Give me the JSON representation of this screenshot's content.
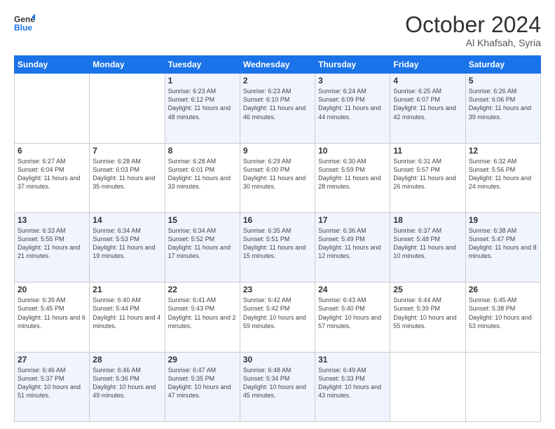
{
  "header": {
    "logo_line1": "General",
    "logo_line2": "Blue",
    "month": "October 2024",
    "location": "Al Khafsah, Syria"
  },
  "days_of_week": [
    "Sunday",
    "Monday",
    "Tuesday",
    "Wednesday",
    "Thursday",
    "Friday",
    "Saturday"
  ],
  "weeks": [
    [
      {
        "day": "",
        "empty": true
      },
      {
        "day": "",
        "empty": true
      },
      {
        "day": "1",
        "line1": "Sunrise: 6:23 AM",
        "line2": "Sunset: 6:12 PM",
        "line3": "Daylight: 11 hours and 48 minutes."
      },
      {
        "day": "2",
        "line1": "Sunrise: 6:23 AM",
        "line2": "Sunset: 6:10 PM",
        "line3": "Daylight: 11 hours and 46 minutes."
      },
      {
        "day": "3",
        "line1": "Sunrise: 6:24 AM",
        "line2": "Sunset: 6:09 PM",
        "line3": "Daylight: 11 hours and 44 minutes."
      },
      {
        "day": "4",
        "line1": "Sunrise: 6:25 AM",
        "line2": "Sunset: 6:07 PM",
        "line3": "Daylight: 11 hours and 42 minutes."
      },
      {
        "day": "5",
        "line1": "Sunrise: 6:26 AM",
        "line2": "Sunset: 6:06 PM",
        "line3": "Daylight: 11 hours and 39 minutes."
      }
    ],
    [
      {
        "day": "6",
        "line1": "Sunrise: 6:27 AM",
        "line2": "Sunset: 6:04 PM",
        "line3": "Daylight: 11 hours and 37 minutes."
      },
      {
        "day": "7",
        "line1": "Sunrise: 6:28 AM",
        "line2": "Sunset: 6:03 PM",
        "line3": "Daylight: 11 hours and 35 minutes."
      },
      {
        "day": "8",
        "line1": "Sunrise: 6:28 AM",
        "line2": "Sunset: 6:01 PM",
        "line3": "Daylight: 11 hours and 33 minutes."
      },
      {
        "day": "9",
        "line1": "Sunrise: 6:29 AM",
        "line2": "Sunset: 6:00 PM",
        "line3": "Daylight: 11 hours and 30 minutes."
      },
      {
        "day": "10",
        "line1": "Sunrise: 6:30 AM",
        "line2": "Sunset: 5:59 PM",
        "line3": "Daylight: 11 hours and 28 minutes."
      },
      {
        "day": "11",
        "line1": "Sunrise: 6:31 AM",
        "line2": "Sunset: 5:57 PM",
        "line3": "Daylight: 11 hours and 26 minutes."
      },
      {
        "day": "12",
        "line1": "Sunrise: 6:32 AM",
        "line2": "Sunset: 5:56 PM",
        "line3": "Daylight: 11 hours and 24 minutes."
      }
    ],
    [
      {
        "day": "13",
        "line1": "Sunrise: 6:33 AM",
        "line2": "Sunset: 5:55 PM",
        "line3": "Daylight: 11 hours and 21 minutes."
      },
      {
        "day": "14",
        "line1": "Sunrise: 6:34 AM",
        "line2": "Sunset: 5:53 PM",
        "line3": "Daylight: 11 hours and 19 minutes."
      },
      {
        "day": "15",
        "line1": "Sunrise: 6:34 AM",
        "line2": "Sunset: 5:52 PM",
        "line3": "Daylight: 11 hours and 17 minutes."
      },
      {
        "day": "16",
        "line1": "Sunrise: 6:35 AM",
        "line2": "Sunset: 5:51 PM",
        "line3": "Daylight: 11 hours and 15 minutes."
      },
      {
        "day": "17",
        "line1": "Sunrise: 6:36 AM",
        "line2": "Sunset: 5:49 PM",
        "line3": "Daylight: 11 hours and 12 minutes."
      },
      {
        "day": "18",
        "line1": "Sunrise: 6:37 AM",
        "line2": "Sunset: 5:48 PM",
        "line3": "Daylight: 11 hours and 10 minutes."
      },
      {
        "day": "19",
        "line1": "Sunrise: 6:38 AM",
        "line2": "Sunset: 5:47 PM",
        "line3": "Daylight: 11 hours and 8 minutes."
      }
    ],
    [
      {
        "day": "20",
        "line1": "Sunrise: 6:39 AM",
        "line2": "Sunset: 5:45 PM",
        "line3": "Daylight: 11 hours and 6 minutes."
      },
      {
        "day": "21",
        "line1": "Sunrise: 6:40 AM",
        "line2": "Sunset: 5:44 PM",
        "line3": "Daylight: 11 hours and 4 minutes."
      },
      {
        "day": "22",
        "line1": "Sunrise: 6:41 AM",
        "line2": "Sunset: 5:43 PM",
        "line3": "Daylight: 11 hours and 2 minutes."
      },
      {
        "day": "23",
        "line1": "Sunrise: 6:42 AM",
        "line2": "Sunset: 5:42 PM",
        "line3": "Daylight: 10 hours and 59 minutes."
      },
      {
        "day": "24",
        "line1": "Sunrise: 6:43 AM",
        "line2": "Sunset: 5:40 PM",
        "line3": "Daylight: 10 hours and 57 minutes."
      },
      {
        "day": "25",
        "line1": "Sunrise: 6:44 AM",
        "line2": "Sunset: 5:39 PM",
        "line3": "Daylight: 10 hours and 55 minutes."
      },
      {
        "day": "26",
        "line1": "Sunrise: 6:45 AM",
        "line2": "Sunset: 5:38 PM",
        "line3": "Daylight: 10 hours and 53 minutes."
      }
    ],
    [
      {
        "day": "27",
        "line1": "Sunrise: 6:46 AM",
        "line2": "Sunset: 5:37 PM",
        "line3": "Daylight: 10 hours and 51 minutes."
      },
      {
        "day": "28",
        "line1": "Sunrise: 6:46 AM",
        "line2": "Sunset: 5:36 PM",
        "line3": "Daylight: 10 hours and 49 minutes."
      },
      {
        "day": "29",
        "line1": "Sunrise: 6:47 AM",
        "line2": "Sunset: 5:35 PM",
        "line3": "Daylight: 10 hours and 47 minutes."
      },
      {
        "day": "30",
        "line1": "Sunrise: 6:48 AM",
        "line2": "Sunset: 5:34 PM",
        "line3": "Daylight: 10 hours and 45 minutes."
      },
      {
        "day": "31",
        "line1": "Sunrise: 6:49 AM",
        "line2": "Sunset: 5:33 PM",
        "line3": "Daylight: 10 hours and 43 minutes."
      },
      {
        "day": "",
        "empty": true
      },
      {
        "day": "",
        "empty": true
      }
    ]
  ]
}
